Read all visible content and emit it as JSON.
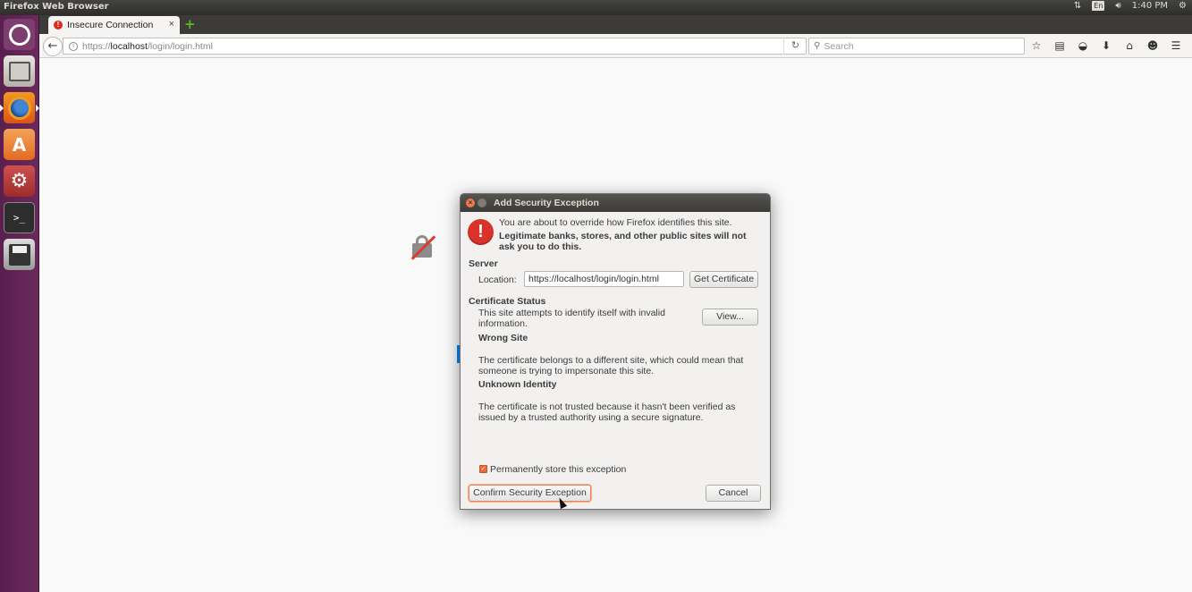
{
  "top_panel": {
    "title": "Firefox Web Browser",
    "language": "En",
    "time": "1:40 PM"
  },
  "launcher": {
    "items": [
      "dash-home",
      "files",
      "firefox",
      "software-center",
      "system-settings",
      "terminal",
      "save"
    ]
  },
  "browser": {
    "tab": {
      "title": "Insecure Connection",
      "close": "×"
    },
    "newtab": "+",
    "url": {
      "prefix": "https://",
      "host": "localhost",
      "path": "/login/login.html"
    },
    "search_placeholder": "Search"
  },
  "dialog": {
    "title": "Add Security Exception",
    "intro": "You are about to override how Firefox identifies this site.",
    "warning": "Legitimate banks, stores, and other public sites will not ask you to do this.",
    "server_heading": "Server",
    "location_label": "Location:",
    "location_value": "https://localhost/login/login.html",
    "get_certificate": "Get Certificate",
    "status_heading": "Certificate Status",
    "status_text": "This site attempts to identify itself with invalid information.",
    "view_button": "View...",
    "wrong_site_heading": "Wrong Site",
    "wrong_site_text": "The certificate belongs to a different site, which could mean that someone is trying to impersonate this site.",
    "unknown_heading": "Unknown Identity",
    "unknown_text": "The certificate is not trusted because it hasn't been verified as issued by a trusted authority using a secure signature.",
    "permanent_label": "Permanently store this exception",
    "permanent_checked": true,
    "confirm_button": "Confirm Security Exception",
    "cancel_button": "Cancel"
  },
  "colors": {
    "launcher": "#5b2350",
    "panel": "#3c3b37",
    "accent": "#e86c3a",
    "error": "#d8322b"
  }
}
